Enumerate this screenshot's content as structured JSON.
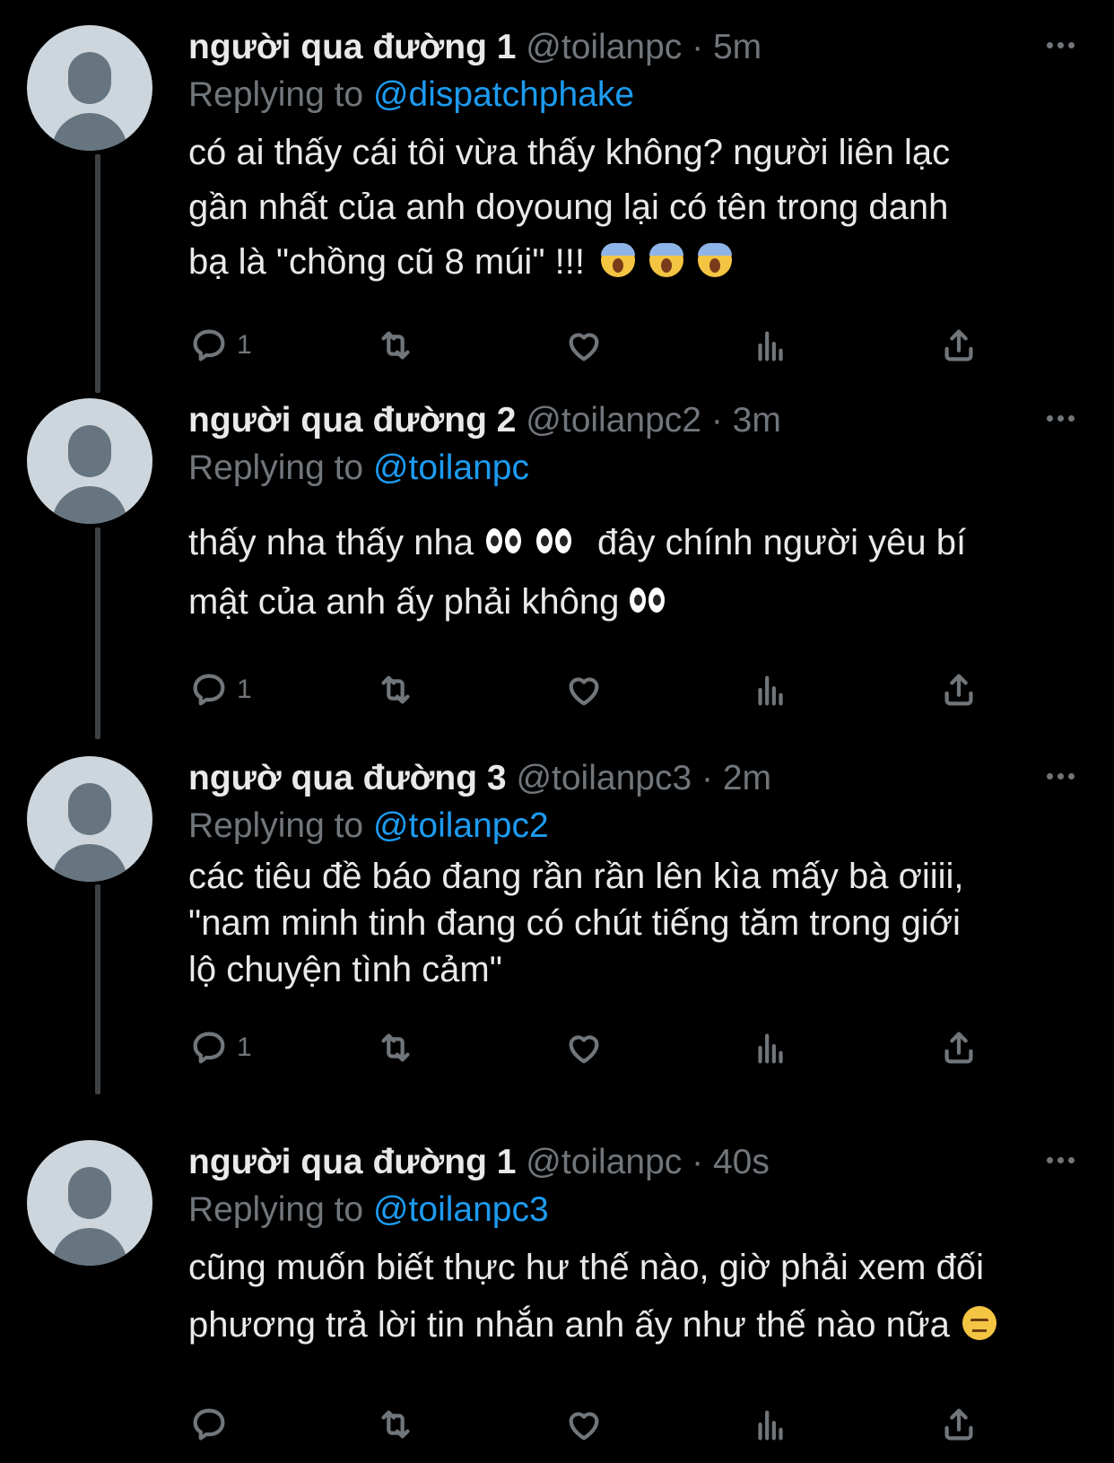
{
  "colors": {
    "background": "#000000",
    "text": "#e7e9ea",
    "muted": "#71767b",
    "mention": "#1d9bf0",
    "connector": "#3e4144",
    "avatar_bg": "#cdd6dd",
    "avatar_fg": "#66757f"
  },
  "tweets": [
    {
      "name": "người qua đường 1",
      "handle": "@toilanpc",
      "sep": "·",
      "time": "5m",
      "replying_label": "Replying to",
      "replying_to": "@dispatchphake",
      "lines": [
        "có ai thấy cái tôi vừa thấy không? người liên lạc",
        "gần nhất của anh doyoung lại có tên trong danh",
        "bạ là \"chồng cũ 8 múi\" !!!"
      ],
      "emoji": [
        "face-screaming-in-fear",
        "face-screaming-in-fear",
        "face-screaming-in-fear"
      ],
      "reply_count": "1",
      "icons": [
        "reply-icon",
        "retweet-icon",
        "like-icon",
        "views-icon",
        "share-icon",
        "more-icon"
      ]
    },
    {
      "name": "người qua đường 2",
      "handle": "@toilanpc2",
      "sep": "·",
      "time": "3m",
      "replying_label": "Replying to",
      "replying_to": "@toilanpc",
      "lines": [
        "thấy nha thấy nha",
        "đây chính người yêu bí",
        "mật của anh ấy phải không"
      ],
      "emoji": [
        "eyes",
        "eyes",
        "eyes"
      ],
      "reply_count": "1"
    },
    {
      "name": "ngườ qua đường 3",
      "handle": "@toilanpc3",
      "sep": "·",
      "time": "2m",
      "replying_label": "Replying to",
      "replying_to": "@toilanpc2",
      "lines": [
        "các tiêu đề báo đang rần rần lên kìa mấy bà ơiiii,",
        "\"nam minh tinh đang có chút tiếng tăm trong giới",
        "lộ chuyện tình cảm\""
      ],
      "reply_count": "1"
    },
    {
      "name": "người qua đường 1",
      "handle": "@toilanpc",
      "sep": "·",
      "time": "40s",
      "replying_label": "Replying to",
      "replying_to": "@toilanpc3",
      "lines": [
        "cũng muốn biết thực hư thế nào, giờ phải xem đối",
        "phương trả lời tin nhắn anh ấy như thế nào nữa"
      ],
      "emoji": [
        "face-with-raised-eyebrow"
      ],
      "reply_count": ""
    }
  ]
}
